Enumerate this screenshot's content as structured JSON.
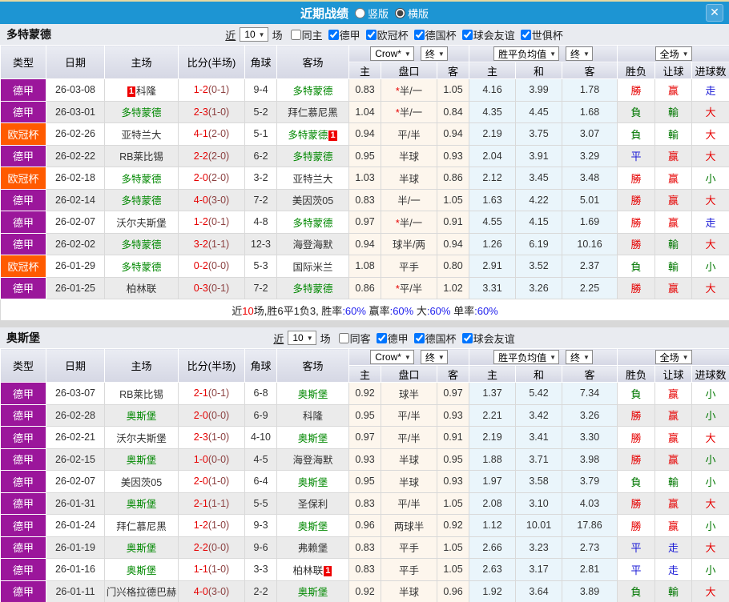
{
  "titlebar": {
    "title": "近期战绩",
    "radios": [
      {
        "label": "竖版",
        "checked": false
      },
      {
        "label": "横版",
        "checked": true
      }
    ],
    "close_label": "✕"
  },
  "table_header": {
    "cols": [
      "类型",
      "日期",
      "主场",
      "比分(半场)",
      "角球",
      "客场"
    ],
    "sub": [
      "主",
      "盘口",
      "客",
      "主",
      "和",
      "客",
      "胜负",
      "让球",
      "进球数"
    ],
    "sel_crow": "Crow*",
    "sel_final1": "终",
    "sel_avg": "胜平负均值",
    "sel_final2": "终",
    "sel_full": "全场"
  },
  "colors": {
    "league": {
      "德甲": "#9b169b",
      "欧冠杯": "#ff5a00"
    },
    "result": {
      "勝": "#e60000",
      "負": "#007700",
      "平": "#1a1ad6",
      "赢": "#e60000",
      "輸": "#007700",
      "走": "#1a1ad6",
      "大": "#e60000",
      "小": "#007700"
    },
    "summary": {
      "k": "#222222",
      "r": "#ee0000",
      "b": "#2222ee"
    },
    "focus_team": "#008800",
    "score_full": "#e60000",
    "score_half": "#8b4040",
    "card_badge": "#ee0000"
  },
  "sections": [
    {
      "team": "多特蒙德",
      "filter": {
        "near_label": "近",
        "count": "10",
        "games_label": "场",
        "same": {
          "label": "同主",
          "checked": false
        },
        "comps": [
          {
            "label": "德甲",
            "checked": true
          },
          {
            "label": "欧冠杯",
            "checked": true
          },
          {
            "label": "德国杯",
            "checked": true
          },
          {
            "label": "球会友谊",
            "checked": true
          },
          {
            "label": "世俱杯",
            "checked": true
          }
        ]
      },
      "rows": [
        {
          "league": "德甲",
          "date": "26-03-08",
          "home": {
            "name": "科隆",
            "focus": false,
            "card": "1",
            "card_pos": "before"
          },
          "score": "1-2",
          "half": "(0-1)",
          "corners": "9-4",
          "away": {
            "name": "多特蒙德",
            "focus": true
          },
          "odds": [
            "0.83",
            "*半/一",
            "1.05"
          ],
          "avg": [
            "4.16",
            "3.99",
            "1.78"
          ],
          "results": [
            "勝",
            "赢",
            "走"
          ]
        },
        {
          "league": "德甲",
          "date": "26-03-01",
          "home": {
            "name": "多特蒙德",
            "focus": true
          },
          "score": "2-3",
          "half": "(1-0)",
          "corners": "5-2",
          "away": {
            "name": "拜仁慕尼黑",
            "focus": false
          },
          "odds": [
            "1.04",
            "*半/一",
            "0.84"
          ],
          "avg": [
            "4.35",
            "4.45",
            "1.68"
          ],
          "results": [
            "負",
            "輸",
            "大"
          ]
        },
        {
          "league": "欧冠杯",
          "date": "26-02-26",
          "home": {
            "name": "亚特兰大",
            "focus": false
          },
          "score": "4-1",
          "half": "(2-0)",
          "corners": "5-1",
          "away": {
            "name": "多特蒙德",
            "focus": true,
            "card": "1",
            "card_pos": "after"
          },
          "odds": [
            "0.94",
            "平/半",
            "0.94"
          ],
          "avg": [
            "2.19",
            "3.75",
            "3.07"
          ],
          "results": [
            "負",
            "輸",
            "大"
          ]
        },
        {
          "league": "德甲",
          "date": "26-02-22",
          "home": {
            "name": "RB莱比锡",
            "focus": false
          },
          "score": "2-2",
          "half": "(2-0)",
          "corners": "6-2",
          "away": {
            "name": "多特蒙德",
            "focus": true
          },
          "odds": [
            "0.95",
            "半球",
            "0.93"
          ],
          "avg": [
            "2.04",
            "3.91",
            "3.29"
          ],
          "results": [
            "平",
            "赢",
            "大"
          ]
        },
        {
          "league": "欧冠杯",
          "date": "26-02-18",
          "home": {
            "name": "多特蒙德",
            "focus": true
          },
          "score": "2-0",
          "half": "(2-0)",
          "corners": "3-2",
          "away": {
            "name": "亚特兰大",
            "focus": false
          },
          "odds": [
            "1.03",
            "半球",
            "0.86"
          ],
          "avg": [
            "2.12",
            "3.45",
            "3.48"
          ],
          "results": [
            "勝",
            "赢",
            "小"
          ]
        },
        {
          "league": "德甲",
          "date": "26-02-14",
          "home": {
            "name": "多特蒙德",
            "focus": true
          },
          "score": "4-0",
          "half": "(3-0)",
          "corners": "7-2",
          "away": {
            "name": "美因茨05",
            "focus": false
          },
          "odds": [
            "0.83",
            "半/一",
            "1.05"
          ],
          "avg": [
            "1.63",
            "4.22",
            "5.01"
          ],
          "results": [
            "勝",
            "赢",
            "大"
          ]
        },
        {
          "league": "德甲",
          "date": "26-02-07",
          "home": {
            "name": "沃尔夫斯堡",
            "focus": false
          },
          "score": "1-2",
          "half": "(0-1)",
          "corners": "4-8",
          "away": {
            "name": "多特蒙德",
            "focus": true
          },
          "odds": [
            "0.97",
            "*半/一",
            "0.91"
          ],
          "avg": [
            "4.55",
            "4.15",
            "1.69"
          ],
          "results": [
            "勝",
            "赢",
            "走"
          ]
        },
        {
          "league": "德甲",
          "date": "26-02-02",
          "home": {
            "name": "多特蒙德",
            "focus": true
          },
          "score": "3-2",
          "half": "(1-1)",
          "corners": "12-3",
          "away": {
            "name": "海登海默",
            "focus": false
          },
          "odds": [
            "0.94",
            "球半/两",
            "0.94"
          ],
          "avg": [
            "1.26",
            "6.19",
            "10.16"
          ],
          "results": [
            "勝",
            "輸",
            "大"
          ]
        },
        {
          "league": "欧冠杯",
          "date": "26-01-29",
          "home": {
            "name": "多特蒙德",
            "focus": true
          },
          "score": "0-2",
          "half": "(0-0)",
          "corners": "5-3",
          "away": {
            "name": "国际米兰",
            "focus": false
          },
          "odds": [
            "1.08",
            "平手",
            "0.80"
          ],
          "avg": [
            "2.91",
            "3.52",
            "2.37"
          ],
          "results": [
            "負",
            "輸",
            "小"
          ]
        },
        {
          "league": "德甲",
          "date": "26-01-25",
          "home": {
            "name": "柏林联",
            "focus": false
          },
          "score": "0-3",
          "half": "(0-1)",
          "corners": "7-2",
          "away": {
            "name": "多特蒙德",
            "focus": true
          },
          "odds": [
            "0.86",
            "*平/半",
            "1.02"
          ],
          "avg": [
            "3.31",
            "3.26",
            "2.25"
          ],
          "results": [
            "勝",
            "赢",
            "大"
          ]
        }
      ],
      "summary": [
        [
          "近",
          "k"
        ],
        [
          "10",
          "r"
        ],
        [
          "场,胜6平1负3, ",
          "k"
        ],
        [
          "胜率",
          "k"
        ],
        [
          ":60%",
          "b"
        ],
        [
          " 赢率",
          "k"
        ],
        [
          ":60%",
          "b"
        ],
        [
          " 大",
          "k"
        ],
        [
          ":60%",
          "b"
        ],
        [
          " 单率",
          "k"
        ],
        [
          ":60%",
          "b"
        ]
      ]
    },
    {
      "team": "奥斯堡",
      "filter": {
        "near_label": "近",
        "count": "10",
        "games_label": "场",
        "same": {
          "label": "同客",
          "checked": false
        },
        "comps": [
          {
            "label": "德甲",
            "checked": true
          },
          {
            "label": "德国杯",
            "checked": true
          },
          {
            "label": "球会友谊",
            "checked": true
          }
        ]
      },
      "rows": [
        {
          "league": "德甲",
          "date": "26-03-07",
          "home": {
            "name": "RB莱比锡",
            "focus": false
          },
          "score": "2-1",
          "half": "(0-1)",
          "corners": "6-8",
          "away": {
            "name": "奥斯堡",
            "focus": true
          },
          "odds": [
            "0.92",
            "球半",
            "0.97"
          ],
          "avg": [
            "1.37",
            "5.42",
            "7.34"
          ],
          "results": [
            "負",
            "赢",
            "小"
          ]
        },
        {
          "league": "德甲",
          "date": "26-02-28",
          "home": {
            "name": "奥斯堡",
            "focus": true
          },
          "score": "2-0",
          "half": "(0-0)",
          "corners": "6-9",
          "away": {
            "name": "科隆",
            "focus": false
          },
          "odds": [
            "0.95",
            "平/半",
            "0.93"
          ],
          "avg": [
            "2.21",
            "3.42",
            "3.26"
          ],
          "results": [
            "勝",
            "赢",
            "小"
          ]
        },
        {
          "league": "德甲",
          "date": "26-02-21",
          "home": {
            "name": "沃尔夫斯堡",
            "focus": false
          },
          "score": "2-3",
          "half": "(1-0)",
          "corners": "4-10",
          "away": {
            "name": "奥斯堡",
            "focus": true
          },
          "odds": [
            "0.97",
            "平/半",
            "0.91"
          ],
          "avg": [
            "2.19",
            "3.41",
            "3.30"
          ],
          "results": [
            "勝",
            "赢",
            "大"
          ]
        },
        {
          "league": "德甲",
          "date": "26-02-15",
          "home": {
            "name": "奥斯堡",
            "focus": true
          },
          "score": "1-0",
          "half": "(0-0)",
          "corners": "4-5",
          "away": {
            "name": "海登海默",
            "focus": false
          },
          "odds": [
            "0.93",
            "半球",
            "0.95"
          ],
          "avg": [
            "1.88",
            "3.71",
            "3.98"
          ],
          "results": [
            "勝",
            "赢",
            "小"
          ]
        },
        {
          "league": "德甲",
          "date": "26-02-07",
          "home": {
            "name": "美因茨05",
            "focus": false
          },
          "score": "2-0",
          "half": "(1-0)",
          "corners": "6-4",
          "away": {
            "name": "奥斯堡",
            "focus": true
          },
          "odds": [
            "0.95",
            "半球",
            "0.93"
          ],
          "avg": [
            "1.97",
            "3.58",
            "3.79"
          ],
          "results": [
            "負",
            "輸",
            "小"
          ]
        },
        {
          "league": "德甲",
          "date": "26-01-31",
          "home": {
            "name": "奥斯堡",
            "focus": true
          },
          "score": "2-1",
          "half": "(1-1)",
          "corners": "5-5",
          "away": {
            "name": "圣保利",
            "focus": false
          },
          "odds": [
            "0.83",
            "平/半",
            "1.05"
          ],
          "avg": [
            "2.08",
            "3.10",
            "4.03"
          ],
          "results": [
            "勝",
            "赢",
            "大"
          ]
        },
        {
          "league": "德甲",
          "date": "26-01-24",
          "home": {
            "name": "拜仁慕尼黑",
            "focus": false
          },
          "score": "1-2",
          "half": "(1-0)",
          "corners": "9-3",
          "away": {
            "name": "奥斯堡",
            "focus": true
          },
          "odds": [
            "0.96",
            "两球半",
            "0.92"
          ],
          "avg": [
            "1.12",
            "10.01",
            "17.86"
          ],
          "results": [
            "勝",
            "赢",
            "小"
          ]
        },
        {
          "league": "德甲",
          "date": "26-01-19",
          "home": {
            "name": "奥斯堡",
            "focus": true
          },
          "score": "2-2",
          "half": "(0-0)",
          "corners": "9-6",
          "away": {
            "name": "弗赖堡",
            "focus": false
          },
          "odds": [
            "0.83",
            "平手",
            "1.05"
          ],
          "avg": [
            "2.66",
            "3.23",
            "2.73"
          ],
          "results": [
            "平",
            "走",
            "大"
          ]
        },
        {
          "league": "德甲",
          "date": "26-01-16",
          "home": {
            "name": "奥斯堡",
            "focus": true
          },
          "score": "1-1",
          "half": "(1-0)",
          "corners": "3-3",
          "away": {
            "name": "柏林联",
            "focus": false,
            "card": "1",
            "card_pos": "after"
          },
          "odds": [
            "0.83",
            "平手",
            "1.05"
          ],
          "avg": [
            "2.63",
            "3.17",
            "2.81"
          ],
          "results": [
            "平",
            "走",
            "小"
          ]
        },
        {
          "league": "德甲",
          "date": "26-01-11",
          "home": {
            "name": "门兴格拉德巴赫",
            "focus": false
          },
          "score": "4-0",
          "half": "(3-0)",
          "corners": "2-2",
          "away": {
            "name": "奥斯堡",
            "focus": true
          },
          "odds": [
            "0.92",
            "半球",
            "0.96"
          ],
          "avg": [
            "1.92",
            "3.64",
            "3.89"
          ],
          "results": [
            "負",
            "輸",
            "大"
          ]
        }
      ],
      "summary": null
    }
  ]
}
